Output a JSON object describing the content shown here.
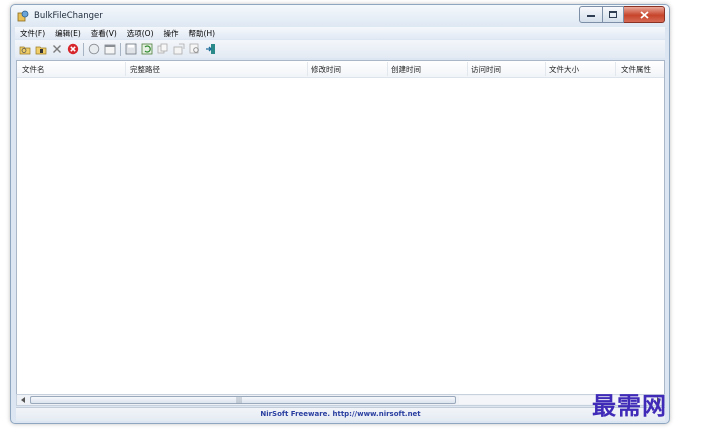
{
  "window": {
    "title": "BulkFileChanger"
  },
  "menu": [
    "文件(F)",
    "编辑(E)",
    "查看(V)",
    "选项(O)",
    "操作",
    "帮助(H)"
  ],
  "toolbar": [
    "open-folder-icon",
    "add-folder-icon",
    "remove-icon",
    "clear-icon",
    "options-icon",
    "window-icon",
    "save-icon",
    "refresh-icon",
    "copy-icon",
    "properties-icon",
    "find-icon",
    "exit-icon"
  ],
  "columns": [
    "文件名",
    "完整路径",
    "修改时间",
    "创建时间",
    "访问时间",
    "文件大小",
    "文件属性"
  ],
  "statusbar": {
    "text": "NirSoft Freeware.  http://www.nirsoft.net"
  },
  "watermark": "最需网",
  "colors": {
    "status_text": "#2a3fa0",
    "watermark": "#3f2bb8",
    "close_button": "#c7442b"
  }
}
